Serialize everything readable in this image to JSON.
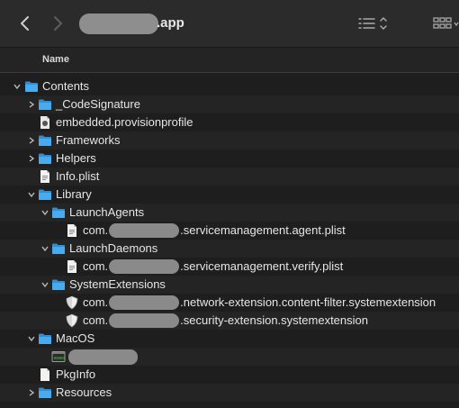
{
  "window": {
    "title_suffix": ".app",
    "back_icon": "chevron-left-icon",
    "forward_icon": "chevron-right-icon",
    "list_view_icon": "list-view-icon",
    "grid_view_icon": "grid-view-icon"
  },
  "columns": {
    "name": "Name"
  },
  "rows": {
    "contents": "Contents",
    "code_signature": "_CodeSignature",
    "embedded_profile": "embedded.provisionprofile",
    "frameworks": "Frameworks",
    "helpers": "Helpers",
    "info_plist": "Info.plist",
    "library": "Library",
    "launch_agents": "LaunchAgents",
    "agent_plist_prefix": "com.",
    "agent_plist_suffix": ".servicemanagement.agent.plist",
    "launch_daemons": "LaunchDaemons",
    "verify_plist_prefix": "com.",
    "verify_plist_suffix": ".servicemanagement.verify.plist",
    "system_extensions": "SystemExtensions",
    "net_ext_prefix": "com.",
    "net_ext_suffix": ".network-extension.content-filter.systemextension",
    "sec_ext_prefix": "com.",
    "sec_ext_suffix": ".security-extension.systemextension",
    "macos": "MacOS",
    "pkginfo": "PkgInfo",
    "resources": "Resources"
  },
  "colors": {
    "folder": "#3aa0e6",
    "background": "#1e1e1e",
    "redaction": "#8e8e8e"
  }
}
